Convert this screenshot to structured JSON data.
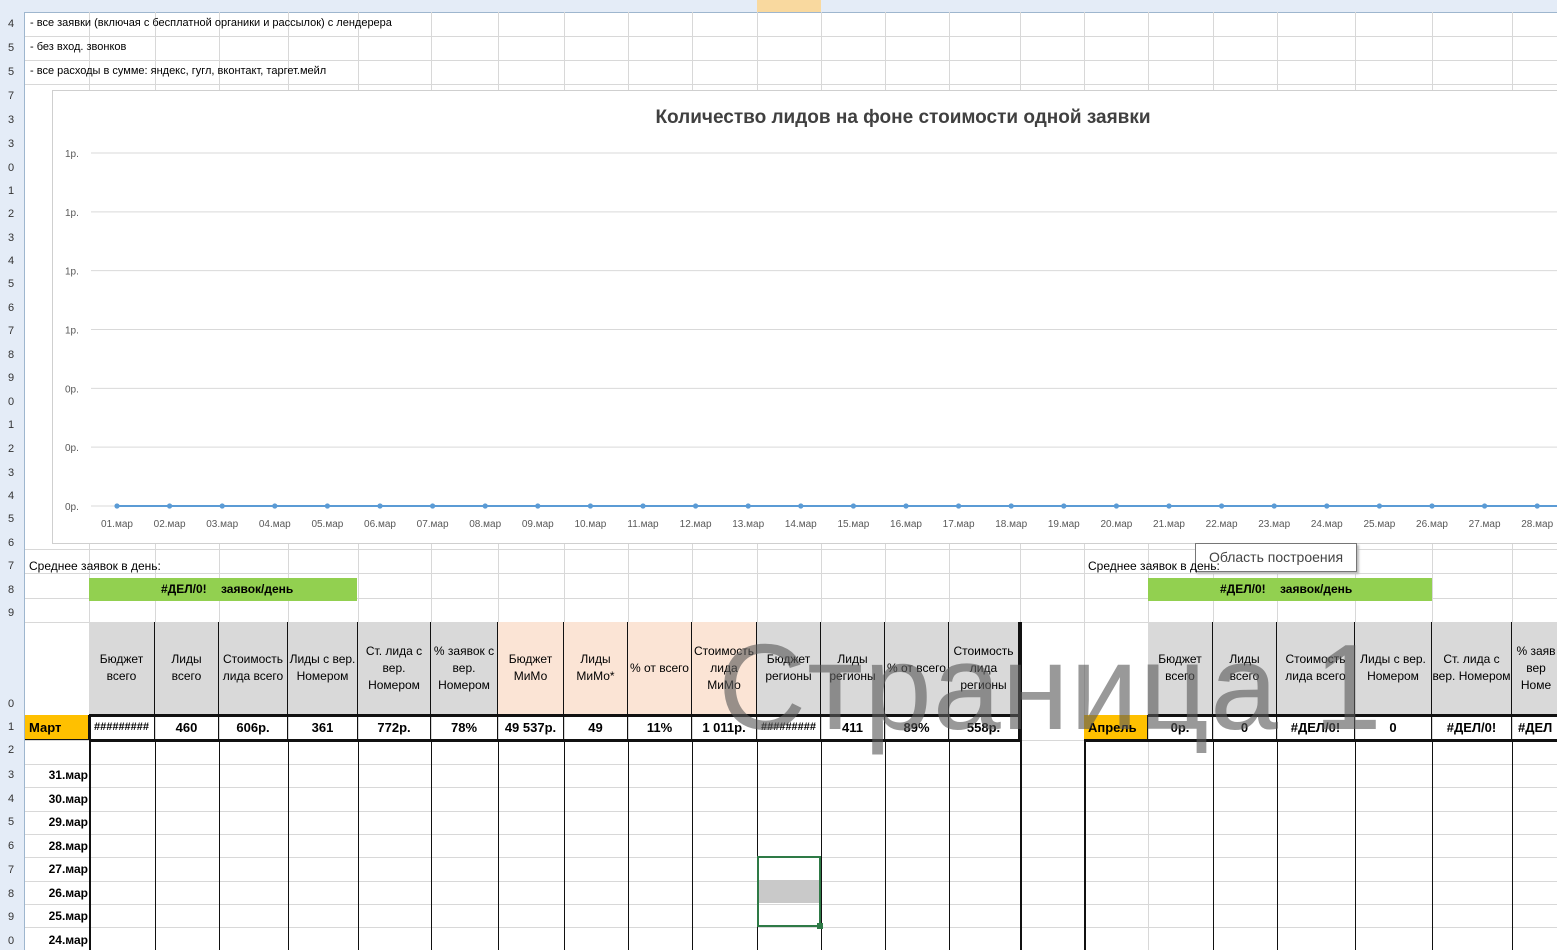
{
  "notes": [
    "- все заявки (включая с бесплатной органики и рассылок) с лендерера",
    "- без вход. звонков",
    "- все расходы в сумме: яндекс, гугл, вконтакт, таргет.мейл"
  ],
  "row_numbers": [
    "4",
    "5",
    "5",
    "7",
    "3",
    "3",
    "0",
    "1",
    "2",
    "3",
    "4",
    "5",
    "6",
    "7",
    "8",
    "9",
    "0",
    "1",
    "2",
    "3",
    "4",
    "5",
    "6",
    "7",
    "8",
    "9",
    "0",
    "1",
    "2",
    "3",
    "4",
    "5",
    "6",
    "7",
    "8",
    "9",
    "0"
  ],
  "chart": {
    "title": "Количество лидов на фоне стоимости одной заявки",
    "tooltip": "Область построения"
  },
  "chart_data": {
    "type": "line",
    "title": "Количество лидов на фоне стоимости одной заявки",
    "y_tick_labels": [
      "1р.",
      "1р.",
      "1р.",
      "1р.",
      "0р.",
      "0р.",
      "0р."
    ],
    "x": [
      "01.мар",
      "02.мар",
      "03.мар",
      "04.мар",
      "05.мар",
      "06.мар",
      "07.мар",
      "08.мар",
      "09.мар",
      "10.мар",
      "11.мар",
      "12.мар",
      "13.мар",
      "14.мар",
      "15.мар",
      "16.мар",
      "17.мар",
      "18.мар",
      "19.мар",
      "20.мар",
      "21.мар",
      "22.мар",
      "23.мар",
      "24.мар",
      "25.мар",
      "26.мар",
      "27.мар",
      "28.мар"
    ],
    "series": [
      {
        "values": [
          0,
          0,
          0,
          0,
          0,
          0,
          0,
          0,
          0,
          0,
          0,
          0,
          0,
          0,
          0,
          0,
          0,
          0,
          0,
          0,
          0,
          0,
          0,
          0,
          0,
          0,
          0,
          0
        ],
        "color": "#5b9bd5"
      }
    ],
    "grid": true,
    "legend": "none"
  },
  "march": {
    "avg_label": "Среднее заявок в день:",
    "avg_value": "#ДЕЛ/0!",
    "avg_unit": "заявок/день",
    "headers": [
      "Бюджет всего",
      "Лиды всего",
      "Стоимость лида всего",
      "Лиды с вер. Номером",
      "Ст. лида с вер. Номером",
      "% заявок с вер. Номером",
      "Бюджет МиМо",
      "Лиды МиМо*",
      "% от всего",
      "Стоимость лида МиМо",
      "Бюджет регионы",
      "Лиды регионы",
      "% от всего",
      "Стоимость лида регионы"
    ],
    "month_label": "Март",
    "values": [
      "#########",
      "460",
      "606р.",
      "361",
      "772р.",
      "78%",
      "49 537р.",
      "49",
      "11%",
      "1 011р.",
      "#########",
      "411",
      "89%",
      "558р."
    ],
    "dates": [
      "31.мар",
      "30.мар",
      "29.мар",
      "28.мар",
      "27.мар",
      "26.мар",
      "25.мар",
      "24.мар"
    ]
  },
  "april": {
    "avg_label": "Среднее заявок в день:",
    "avg_value": "#ДЕЛ/0!",
    "avg_unit": "заявок/день",
    "headers": [
      "Бюджет всего",
      "Лиды всего",
      "Стоимость лида всего",
      "Лиды с вер. Номером",
      "Ст. лида с вер. Номером",
      "% заяв вер Номе"
    ],
    "month_label": "Апрель",
    "values": [
      "0р.",
      "0",
      "#ДЕЛ/0!",
      "0",
      "#ДЕЛ/0!",
      "#ДЕЛ"
    ]
  },
  "watermark": "Страница 1",
  "colors": {
    "header_gray": "#d9d9d9",
    "header_peach": "#fbe4d5",
    "month": "#ffc000",
    "green": "#92d050",
    "line": "#5b9bd5"
  }
}
